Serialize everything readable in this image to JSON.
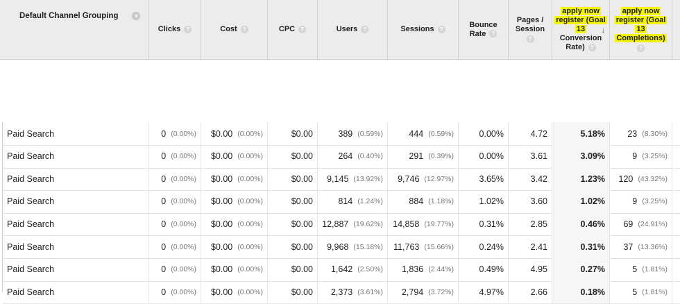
{
  "header": {
    "dimension": "Default Channel Grouping",
    "clicks": "Clicks",
    "cost": "Cost",
    "cpc": "CPC",
    "users": "Users",
    "sessions": "Sessions",
    "bounce_rate_1": "Bounce",
    "bounce_rate_2": "Rate",
    "pages_session_1": "Pages /",
    "pages_session_2": "Session",
    "goal_rate_1": "apply now",
    "goal_rate_2": "register (Goal",
    "goal_rate_3": "13",
    "goal_rate_4": "Conversion",
    "goal_rate_5": "Rate)",
    "goal_comp_1": "apply now",
    "goal_comp_2": "register (Goal",
    "goal_comp_3": "13",
    "goal_comp_4": "Completions)",
    "help_glyph": "?",
    "remove_glyph": "×",
    "sort_glyph": "↓"
  },
  "colors": {
    "highlight": "#f4f40a",
    "header_bg": "#ececec"
  },
  "rows": [
    {
      "name": "Paid Search",
      "clicks": "0",
      "clicks_pct": "(0.00%)",
      "cost": "$0.00",
      "cost_pct": "(0.00%)",
      "cpc": "$0.00",
      "users": "389",
      "users_pct": "(0.59%)",
      "sessions": "444",
      "sessions_pct": "(0.59%)",
      "bounce": "0.00%",
      "pages": "4.72",
      "conv_rate": "5.18%",
      "completions": "23",
      "completions_pct": "(8.30%)"
    },
    {
      "name": "Paid Search",
      "clicks": "0",
      "clicks_pct": "(0.00%)",
      "cost": "$0.00",
      "cost_pct": "(0.00%)",
      "cpc": "$0.00",
      "users": "264",
      "users_pct": "(0.40%)",
      "sessions": "291",
      "sessions_pct": "(0.39%)",
      "bounce": "0.00%",
      "pages": "3.61",
      "conv_rate": "3.09%",
      "completions": "9",
      "completions_pct": "(3.25%)"
    },
    {
      "name": "Paid Search",
      "clicks": "0",
      "clicks_pct": "(0.00%)",
      "cost": "$0.00",
      "cost_pct": "(0.00%)",
      "cpc": "$0.00",
      "users": "9,145",
      "users_pct": "(13.92%)",
      "sessions": "9,746",
      "sessions_pct": "(12.97%)",
      "bounce": "3.65%",
      "pages": "3.42",
      "conv_rate": "1.23%",
      "completions": "120",
      "completions_pct": "(43.32%)"
    },
    {
      "name": "Paid Search",
      "clicks": "0",
      "clicks_pct": "(0.00%)",
      "cost": "$0.00",
      "cost_pct": "(0.00%)",
      "cpc": "$0.00",
      "users": "814",
      "users_pct": "(1.24%)",
      "sessions": "884",
      "sessions_pct": "(1.18%)",
      "bounce": "1.02%",
      "pages": "3.60",
      "conv_rate": "1.02%",
      "completions": "9",
      "completions_pct": "(3.25%)"
    },
    {
      "name": "Paid Search",
      "clicks": "0",
      "clicks_pct": "(0.00%)",
      "cost": "$0.00",
      "cost_pct": "(0.00%)",
      "cpc": "$0.00",
      "users": "12,887",
      "users_pct": "(19.62%)",
      "sessions": "14,858",
      "sessions_pct": "(19.77%)",
      "bounce": "0.31%",
      "pages": "2.85",
      "conv_rate": "0.46%",
      "completions": "69",
      "completions_pct": "(24.91%)"
    },
    {
      "name": "Paid Search",
      "clicks": "0",
      "clicks_pct": "(0.00%)",
      "cost": "$0.00",
      "cost_pct": "(0.00%)",
      "cpc": "$0.00",
      "users": "9,968",
      "users_pct": "(15.18%)",
      "sessions": "11,763",
      "sessions_pct": "(15.66%)",
      "bounce": "0.24%",
      "pages": "2.41",
      "conv_rate": "0.31%",
      "completions": "37",
      "completions_pct": "(13.36%)"
    },
    {
      "name": "Paid Search",
      "clicks": "0",
      "clicks_pct": "(0.00%)",
      "cost": "$0.00",
      "cost_pct": "(0.00%)",
      "cpc": "$0.00",
      "users": "1,642",
      "users_pct": "(2.50%)",
      "sessions": "1,836",
      "sessions_pct": "(2.44%)",
      "bounce": "0.49%",
      "pages": "4.95",
      "conv_rate": "0.27%",
      "completions": "5",
      "completions_pct": "(1.81%)"
    },
    {
      "name": "Paid Search",
      "clicks": "0",
      "clicks_pct": "(0.00%)",
      "cost": "$0.00",
      "cost_pct": "(0.00%)",
      "cpc": "$0.00",
      "users": "2,373",
      "users_pct": "(3.61%)",
      "sessions": "2,794",
      "sessions_pct": "(3.72%)",
      "bounce": "4.97%",
      "pages": "2.66",
      "conv_rate": "0.18%",
      "completions": "5",
      "completions_pct": "(1.81%)"
    }
  ]
}
